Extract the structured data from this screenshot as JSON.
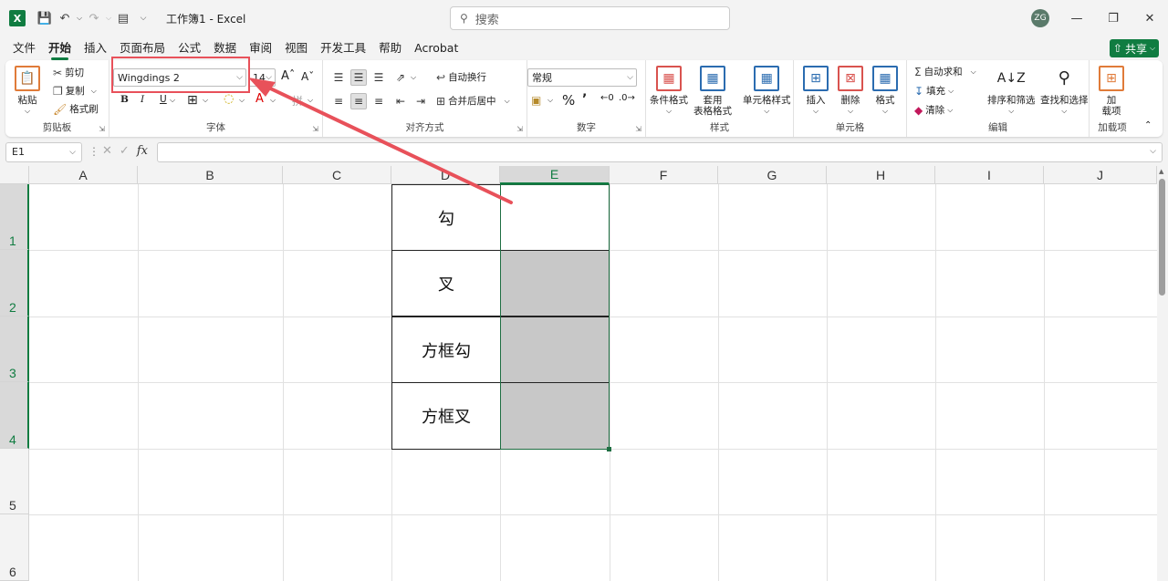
{
  "title_bar": {
    "app_icon_letter": "X",
    "doc_title": "工作簿1 - Excel",
    "search_placeholder": "搜索",
    "avatar_initials": "ZG"
  },
  "menu_tabs": [
    "文件",
    "开始",
    "插入",
    "页面布局",
    "公式",
    "数据",
    "审阅",
    "视图",
    "开发工具",
    "帮助",
    "Acrobat"
  ],
  "active_tab": "开始",
  "share_label": "共享",
  "ribbon": {
    "clipboard": {
      "paste": "粘贴",
      "cut": "剪切",
      "copy": "复制",
      "format_painter": "格式刷",
      "label": "剪贴板"
    },
    "font": {
      "font_name": "Wingdings 2",
      "font_size": "14",
      "bold": "B",
      "italic": "I",
      "underline": "U",
      "label": "字体"
    },
    "alignment": {
      "wrap_text": "自动换行",
      "merge_center": "合并后居中",
      "label": "对齐方式"
    },
    "number": {
      "format": "常规",
      "label": "数字"
    },
    "styles": {
      "conditional": "条件格式",
      "table_format_1": "套用",
      "table_format_2": "表格格式",
      "cell_styles": "单元格样式",
      "label": "样式"
    },
    "cells": {
      "insert": "插入",
      "delete": "删除",
      "format": "格式",
      "label": "单元格"
    },
    "editing": {
      "autosum": "自动求和",
      "fill": "填充",
      "clear": "清除",
      "sort_filter": "排序和筛选",
      "find_select": "查找和选择",
      "label": "编辑"
    },
    "addins": {
      "addin_1": "加",
      "addin_2": "载项",
      "label": "加载项"
    }
  },
  "formula_bar": {
    "name_box": "E1",
    "fx": "fx",
    "formula": ""
  },
  "sheet": {
    "columns": [
      "A",
      "B",
      "C",
      "D",
      "E",
      "F",
      "G",
      "H",
      "I",
      "J"
    ],
    "selected_column": "E",
    "rows": [
      "1",
      "2",
      "3",
      "4",
      "5",
      "6"
    ],
    "cells_D": [
      "勾",
      "叉",
      "方框勾",
      "方框叉"
    ]
  },
  "colors": {
    "accent": "#107c41",
    "annotation": "#e8515a",
    "cell_fill": "#c8c8c8"
  }
}
